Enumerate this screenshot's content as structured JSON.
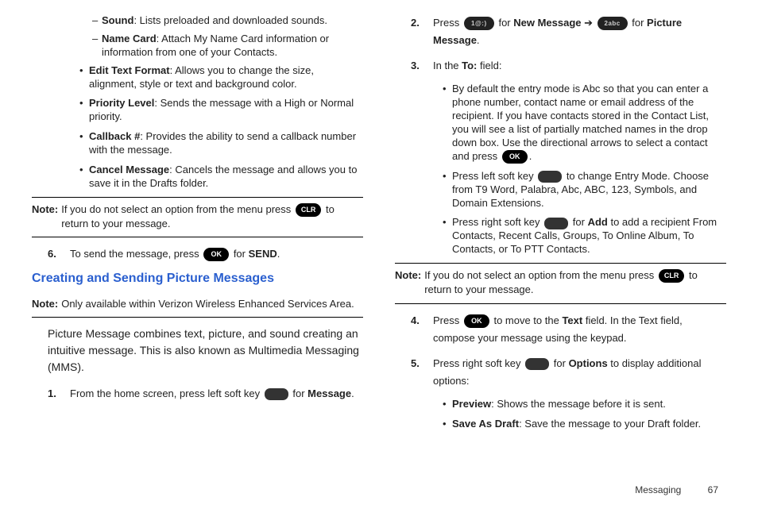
{
  "left": {
    "dash_items": [
      {
        "term": "Sound",
        "desc": ": Lists preloaded and downloaded sounds."
      },
      {
        "term": "Name Card",
        "desc": ": Attach My Name Card information or information from one of your Contacts."
      }
    ],
    "bullets": [
      {
        "term": "Edit Text Format",
        "desc": ": Allows you to change the size, alignment, style or text and background color."
      },
      {
        "term": "Priority Level",
        "desc": ": Sends the message with a High or Normal priority."
      },
      {
        "term": "Callback #",
        "desc": ": Provides the ability to send a callback number with the message."
      },
      {
        "term": "Cancel Message",
        "desc": ": Cancels the message and allows you to save it in the Drafts folder."
      }
    ],
    "note1_label": "Note:",
    "note1_before_key": "If you do not select an option from the menu press ",
    "note1_after_key": " to return to your message.",
    "step6_num": "6.",
    "step6_before": "To send the message, press ",
    "step6_after": " for ",
    "step6_bold": "SEND",
    "heading": "Creating and Sending Picture Messages",
    "note2_label": "Note:",
    "note2_body": "Only available within Verizon Wireless Enhanced Services Area.",
    "intro": "Picture Message combines text, picture, and sound creating an intuitive message. This is also known as Multimedia Messaging (MMS).",
    "step1_num": "1.",
    "step1_before": "From the home screen, press left soft key ",
    "step1_after": " for ",
    "step1_bold": "Message",
    "step1_end": "."
  },
  "right": {
    "step2_num": "2.",
    "step2_a": "Press ",
    "step2_pill1": "1@:)",
    "step2_b": " for ",
    "step2_bold1": "New Message",
    "step2_arrow": " ➔ ",
    "step2_pill2": "2abc",
    "step2_c": " for ",
    "step2_bold2": "Picture Message",
    "step2_end": ".",
    "step3_num": "3.",
    "step3_a": "In the ",
    "step3_bold": "To:",
    "step3_b": " field:",
    "step3_bullets": [
      {
        "type": "entry",
        "before": "By default the entry mode is Abc so that you can enter a phone number, contact name or email address of the recipient. If you have contacts stored in the Contact List, you will see a list of partially matched names in the drop down box. Use the directional arrows to select a contact and press ",
        "after": "."
      },
      {
        "type": "softleft",
        "before": "Press left soft key ",
        "after": " to change Entry Mode. Choose from T9 Word, Palabra, Abc, ABC, 123, Symbols, and Domain Extensions."
      },
      {
        "type": "softright",
        "before": "Press right soft key ",
        "mid_a": " for ",
        "bold": "Add",
        "mid_b": " to add a recipient From Contacts, Recent Calls, Groups, To Online Album, To Contacts, or To PTT Contacts."
      }
    ],
    "note3_label": "Note:",
    "note3_before": "If you do not select an option from the menu press ",
    "note3_after": " to return to your message.",
    "step4_num": "4.",
    "step4_a": "Press ",
    "step4_b": " to move to the ",
    "step4_bold1": "Text",
    "step4_c": " field. In the Text field, compose your message using the keypad.",
    "step5_num": "5.",
    "step5_a": "Press right soft key ",
    "step5_b": " for ",
    "step5_bold": "Options",
    "step5_c": " to display additional options:",
    "step5_bullets": [
      {
        "term": "Preview",
        "desc": ": Shows the message before it is sent."
      },
      {
        "term": "Save As Draft",
        "desc": ": Save the message to your Draft folder."
      }
    ]
  },
  "footer": {
    "section": "Messaging",
    "page": "67"
  }
}
